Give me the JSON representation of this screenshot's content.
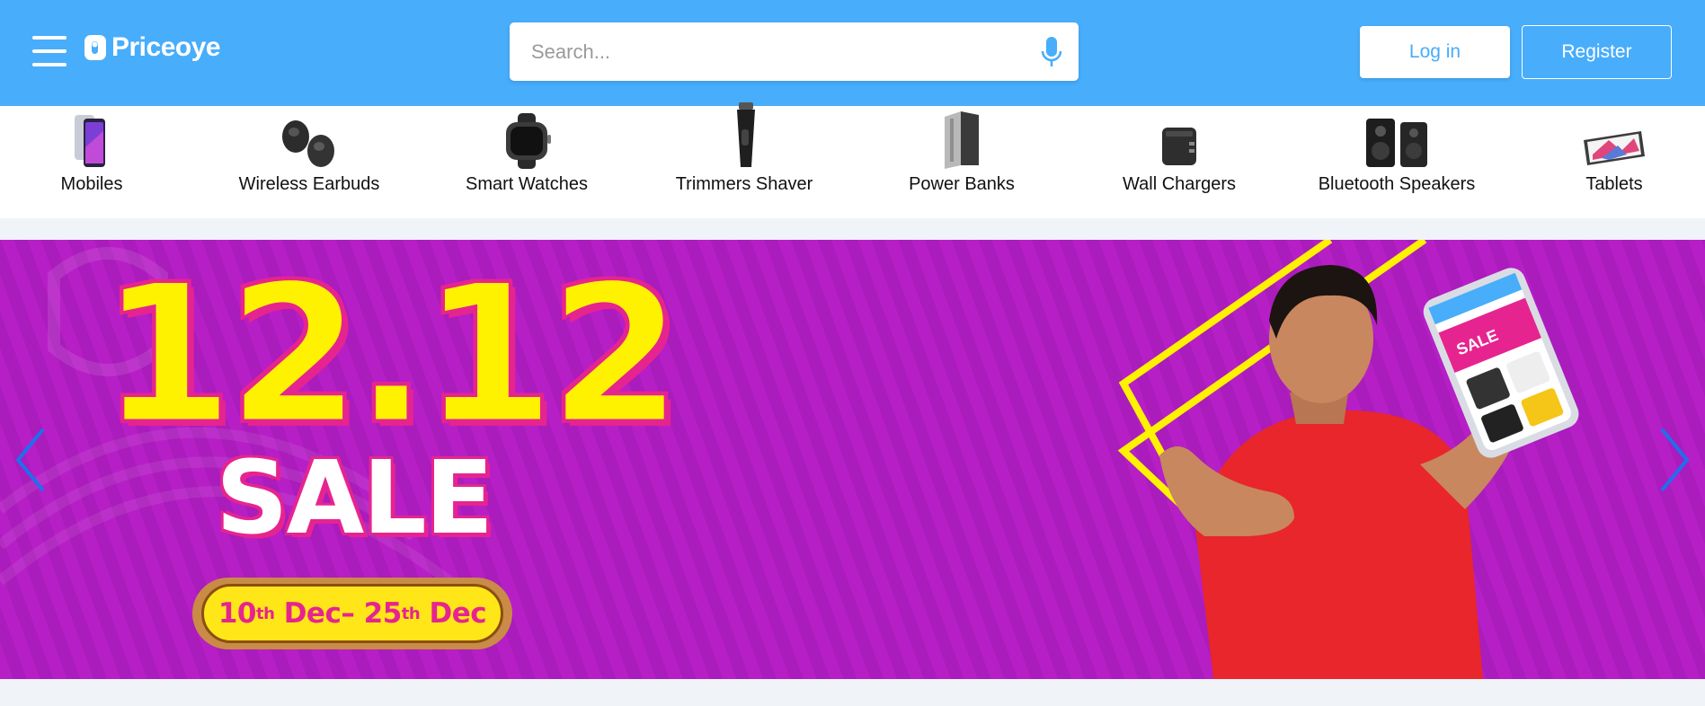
{
  "header": {
    "logo_text": "Priceoye",
    "search_placeholder": "Search...",
    "login_label": "Log in",
    "register_label": "Register",
    "brand_color": "#48adfb"
  },
  "categories": [
    {
      "label": "Mobiles",
      "icon": "mobile-phone-icon"
    },
    {
      "label": "Wireless Earbuds",
      "icon": "earbuds-icon"
    },
    {
      "label": "Smart Watches",
      "icon": "smart-watch-icon"
    },
    {
      "label": "Trimmers Shaver",
      "icon": "trimmer-icon"
    },
    {
      "label": "Power Banks",
      "icon": "power-bank-icon"
    },
    {
      "label": "Wall Chargers",
      "icon": "wall-charger-icon"
    },
    {
      "label": "Bluetooth Speakers",
      "icon": "speaker-icon"
    },
    {
      "label": "Tablets",
      "icon": "tablet-icon"
    }
  ],
  "banner": {
    "headline": "12.12",
    "subheadline": "SALE",
    "date_start_day": "10",
    "date_start_suffix": "th",
    "date_start_month": "Dec",
    "date_end_day": "25",
    "date_end_suffix": "th",
    "date_end_month": "Dec",
    "phone_screen_text": "SALE",
    "background_color": "#b61fc6",
    "accent_color": "#fff200"
  }
}
